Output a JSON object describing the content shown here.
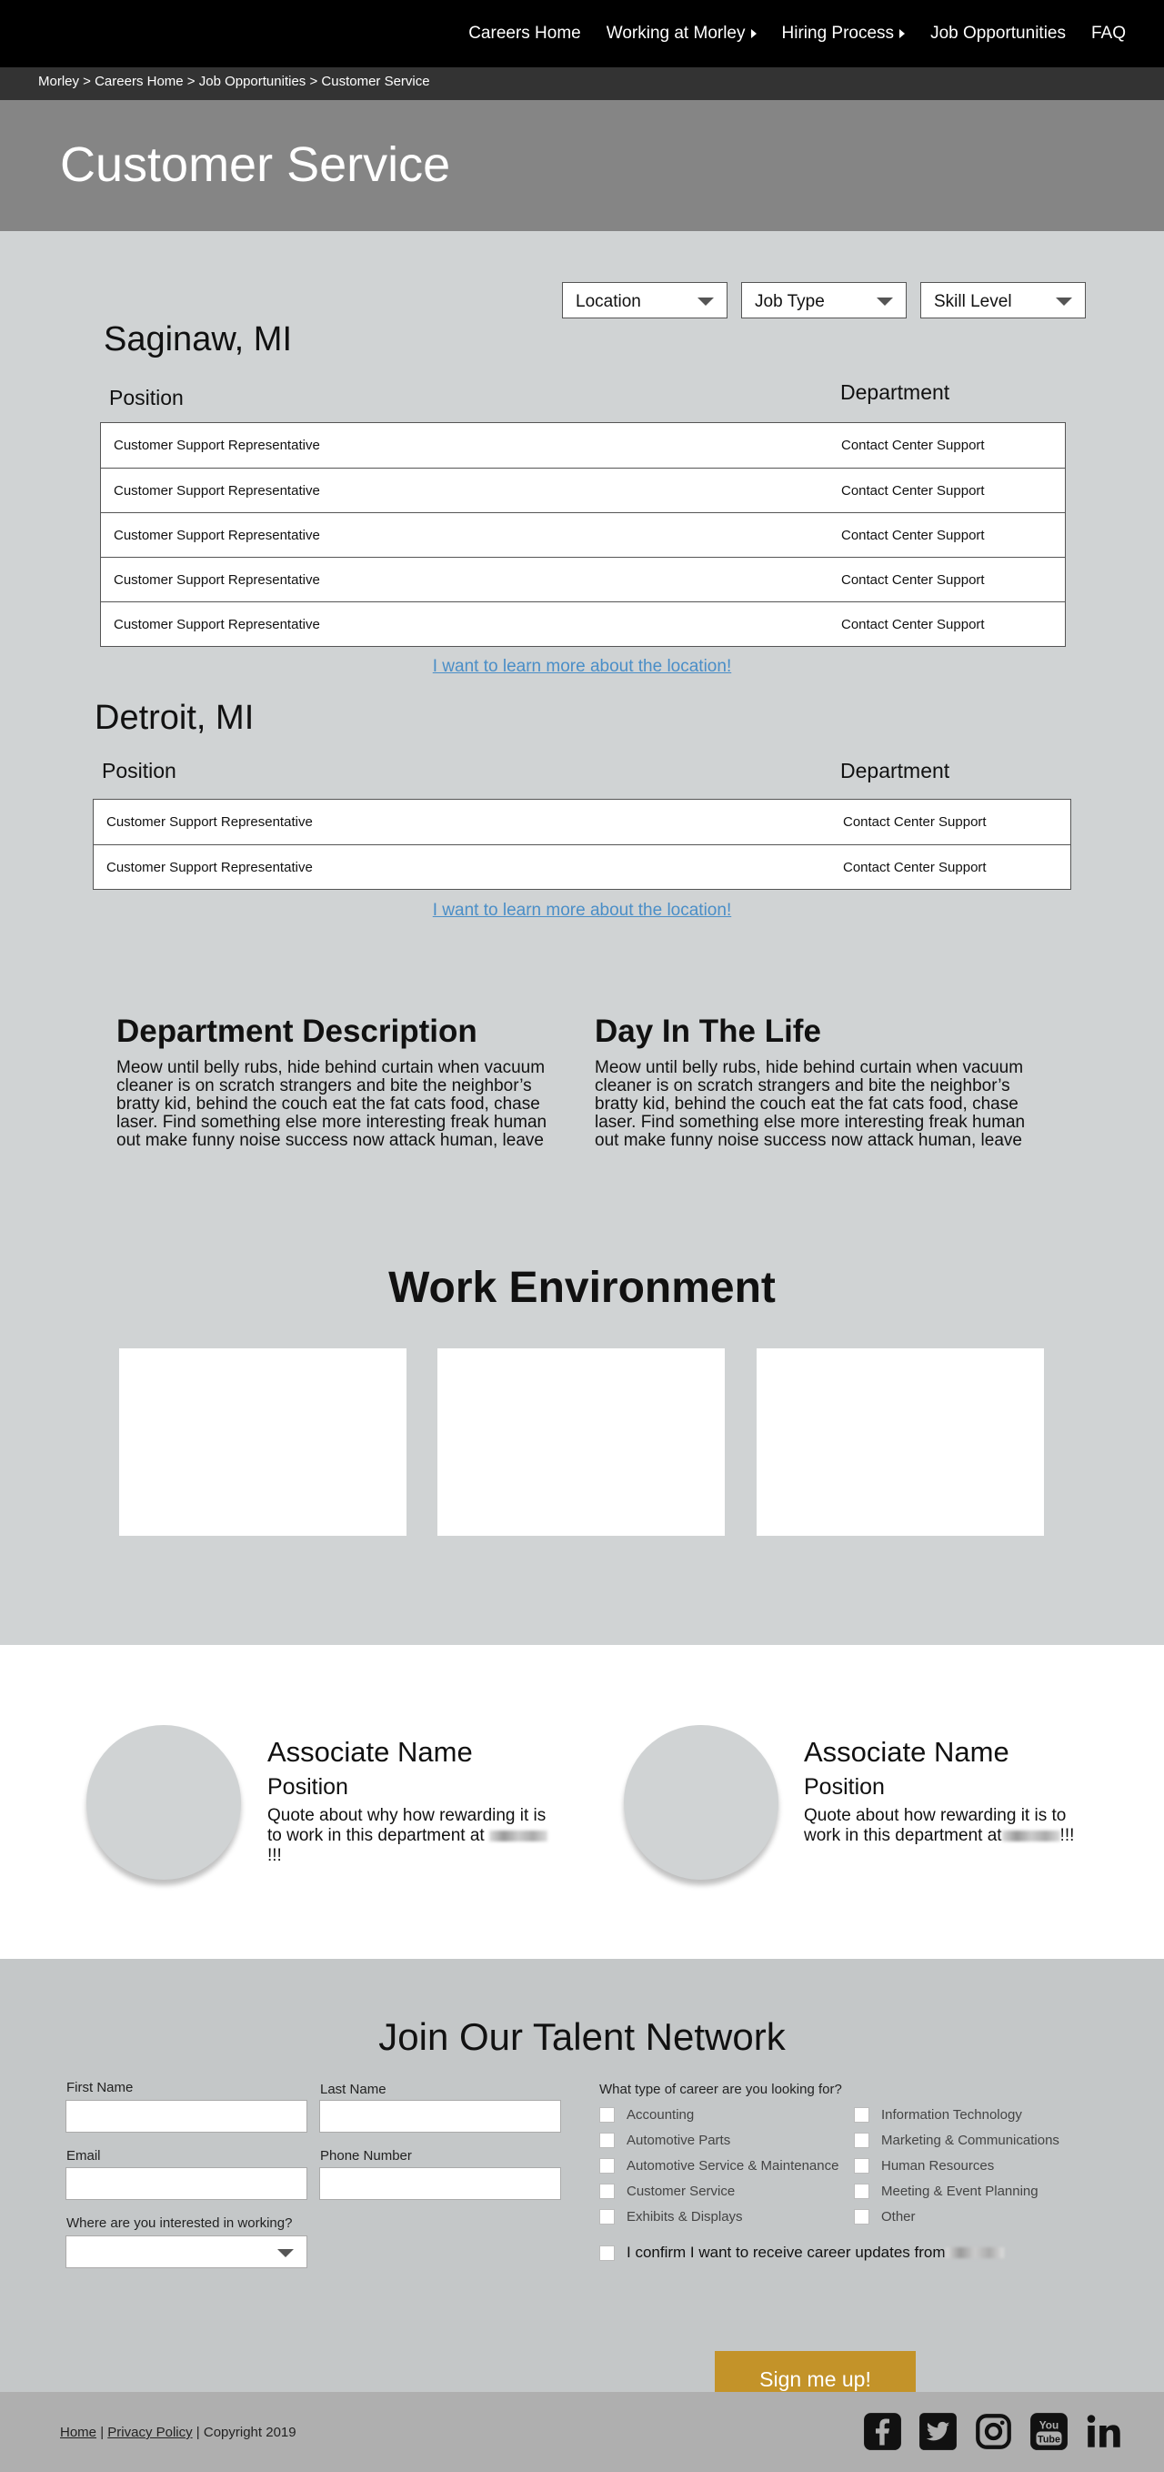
{
  "nav": {
    "items": [
      "Careers Home",
      "Working at Morley",
      "Hiring Process",
      "Job Opportunities",
      "FAQ"
    ]
  },
  "breadcrumb": "Morley > Careers Home > Job Opportunities > Customer Service",
  "page_title": "Customer Service",
  "filters": {
    "location": "Location",
    "job_type": "Job Type",
    "skill_level": "Skill Level"
  },
  "locations": [
    {
      "city": "Saginaw, MI",
      "position_header": "Position",
      "department_header": "Department",
      "jobs": [
        {
          "position": "Customer Support Representative",
          "department": "Contact Center Support"
        },
        {
          "position": "Customer Support Representative",
          "department": "Contact Center Support"
        },
        {
          "position": "Customer Support Representative",
          "department": "Contact Center Support"
        },
        {
          "position": "Customer Support Representative",
          "department": "Contact Center Support"
        },
        {
          "position": "Customer Support Representative",
          "department": "Contact Center Support"
        }
      ],
      "learn_more": "I want to learn more about the location!"
    },
    {
      "city": "Detroit, MI",
      "position_header": "Position",
      "department_header": "Department",
      "jobs": [
        {
          "position": "Customer Support Representative",
          "department": "Contact Center Support"
        },
        {
          "position": "Customer Support Representative",
          "department": "Contact Center Support"
        }
      ],
      "learn_more": "I want to learn more about the location!"
    }
  ],
  "department_description": {
    "title": "Department Description",
    "text": "Meow until belly rubs, hide behind curtain when vacuum cleaner is on scratch strangers and bite the neighbor’s bratty kid, behind the couch eat the fat cats food, chase laser. Find something else more interesting freak human out make funny noise success now attack human, leave"
  },
  "day_in_life": {
    "title": "Day In The Life",
    "text": "Meow until belly rubs, hide behind curtain when vacuum cleaner is on scratch strangers and bite the neighbor’s bratty kid, behind the couch eat the fat cats food, chase laser. Find something else more interesting freak human out make funny noise success now attack human, leave"
  },
  "work_environment": {
    "title": "Work Environment"
  },
  "associates": [
    {
      "name": "Associate Name",
      "position": "Position",
      "quote": "Quote about why how rewarding it is to work in this department at",
      "quote_end": "!!!"
    },
    {
      "name": "Associate Name",
      "position": "Position",
      "quote": "Quote about how rewarding it is to work in this department at",
      "quote_end": "!!!"
    }
  ],
  "talent_network": {
    "title": "Join Our Talent Network",
    "first_name": "First Name",
    "last_name": "Last Name",
    "email": "Email",
    "phone": "Phone Number",
    "interest": "Where are you interested in working?",
    "career_question": "What type of career are you looking for?",
    "careers_left": [
      "Accounting",
      "Automotive Parts",
      "Automotive Service & Maintenance",
      "Customer Service",
      "Exhibits & Displays"
    ],
    "careers_right": [
      "Information Technology",
      "Marketing & Communications",
      "Human Resources",
      "Meeting & Event Planning",
      "Other"
    ],
    "confirm": "I confirm I want to receive career updates from",
    "signup": "Sign me up!"
  },
  "footer": {
    "home": "Home",
    "privacy": "Privacy Policy",
    "sep": "|",
    "copyright": "| Copyright 2019",
    "social": [
      "facebook-icon",
      "twitter-icon",
      "instagram-icon",
      "youtube-icon",
      "linkedin-icon"
    ]
  },
  "colors": {
    "nav_bg": "#000000",
    "hero_bg": "#858585",
    "content_bg": "#d0d3d4",
    "link": "#4a8ec7",
    "signup_button": "#c39329"
  }
}
